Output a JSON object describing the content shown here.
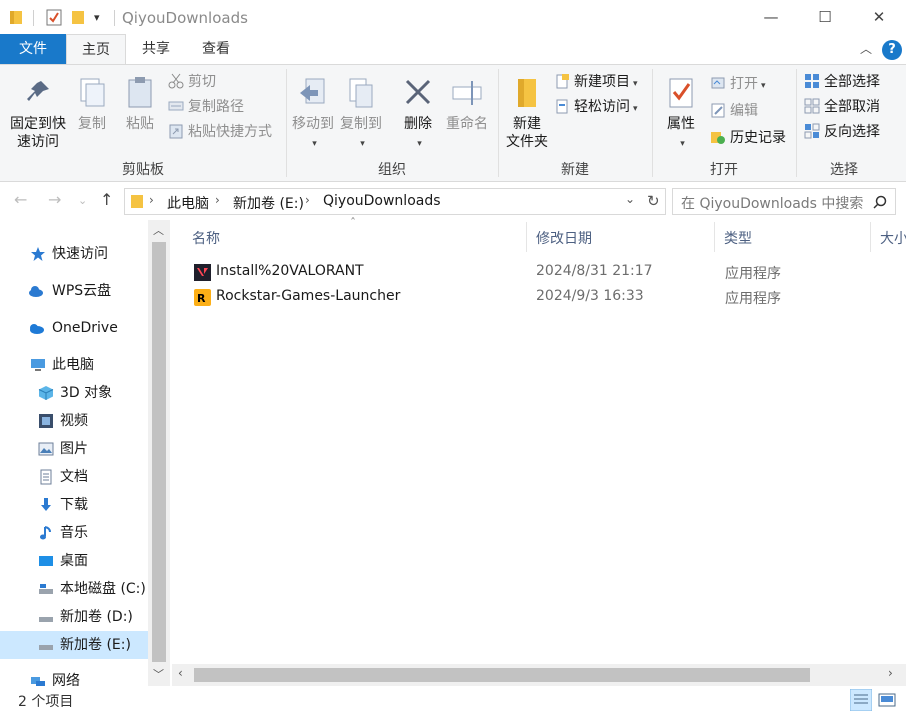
{
  "window": {
    "title": "QiyouDownloads",
    "controls": {
      "minimize": "—",
      "maximize": "☐",
      "close": "✕"
    }
  },
  "tabs": [
    {
      "label": "文件"
    },
    {
      "label": "主页"
    },
    {
      "label": "共享"
    },
    {
      "label": "查看"
    }
  ],
  "ribbon": {
    "clipboard": {
      "pin": "固定到快速访问",
      "pin_line1": "固定到快",
      "pin_line2": "速访问",
      "copy": "复制",
      "paste": "粘贴",
      "cut": "剪切",
      "copy_path": "复制路径",
      "paste_shortcut": "粘贴快捷方式",
      "label": "剪贴板"
    },
    "organize": {
      "move_to": "移动到",
      "copy_to": "复制到",
      "delete": "删除",
      "rename": "重命名",
      "label": "组织"
    },
    "new": {
      "new_folder_line1": "新建",
      "new_folder_line2": "文件夹",
      "new_item": "新建项目",
      "easy_access": "轻松访问",
      "label": "新建"
    },
    "open": {
      "properties": "属性",
      "open": "打开",
      "edit": "编辑",
      "history": "历史记录",
      "label": "打开"
    },
    "select": {
      "select_all": "全部选择",
      "select_none": "全部取消",
      "invert": "反向选择",
      "label": "选择"
    }
  },
  "address": {
    "parts": [
      "此电脑",
      "新加卷 (E:)",
      "QiyouDownloads"
    ],
    "search_placeholder": "在 QiyouDownloads 中搜索"
  },
  "sidebar": {
    "items": [
      {
        "label": "快速访问",
        "icon": "star-icon"
      },
      {
        "label": "WPS云盘",
        "icon": "cloud-icon"
      },
      {
        "label": "OneDrive",
        "icon": "onedrive-icon"
      },
      {
        "label": "此电脑",
        "icon": "computer-icon"
      },
      {
        "label": "3D 对象",
        "icon": "cube-icon"
      },
      {
        "label": "视频",
        "icon": "video-icon"
      },
      {
        "label": "图片",
        "icon": "picture-icon"
      },
      {
        "label": "文档",
        "icon": "document-icon"
      },
      {
        "label": "下载",
        "icon": "download-icon"
      },
      {
        "label": "音乐",
        "icon": "music-icon"
      },
      {
        "label": "桌面",
        "icon": "desktop-icon"
      },
      {
        "label": "本地磁盘 (C:)",
        "icon": "drive-icon"
      },
      {
        "label": "新加卷 (D:)",
        "icon": "drive-icon"
      },
      {
        "label": "新加卷 (E:)",
        "icon": "drive-icon",
        "selected": true
      },
      {
        "label": "网络",
        "icon": "network-icon"
      }
    ]
  },
  "columns": {
    "name": "名称",
    "date": "修改日期",
    "type": "类型",
    "size": "大小"
  },
  "files": [
    {
      "name": "Install%20VALORANT",
      "date": "2024/8/31 21:17",
      "type": "应用程序",
      "icon": "valorant-icon"
    },
    {
      "name": "Rockstar-Games-Launcher",
      "date": "2024/9/3 16:33",
      "type": "应用程序",
      "icon": "rockstar-icon"
    }
  ],
  "status": {
    "count": "2 个项目"
  },
  "colors": {
    "accent": "#1979ca",
    "selected": "#cce8ff",
    "folder": "#f5c342"
  }
}
